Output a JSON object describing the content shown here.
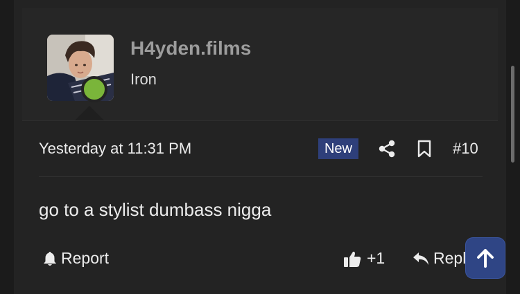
{
  "post": {
    "username": "H4yden.films",
    "user_title": "Iron",
    "timestamp": "Yesterday at 11:31 PM",
    "badge": "New",
    "post_number": "#10",
    "message": "go to a stylist dumbass nigga"
  },
  "actions": {
    "report_label": "Report",
    "like_label": "+1",
    "reply_label": "Reply"
  },
  "icons": {
    "share": "share-icon",
    "bookmark": "bookmark-icon",
    "report": "bell-icon",
    "like": "thumbs-up-icon",
    "reply": "reply-arrow-icon",
    "scroll_top": "arrow-up-icon"
  },
  "colors": {
    "online_status": "#7ab53a",
    "new_badge_bg": "#2e3f7a",
    "scroll_top_bg": "#2f4585",
    "username": "#9c9c9c"
  }
}
